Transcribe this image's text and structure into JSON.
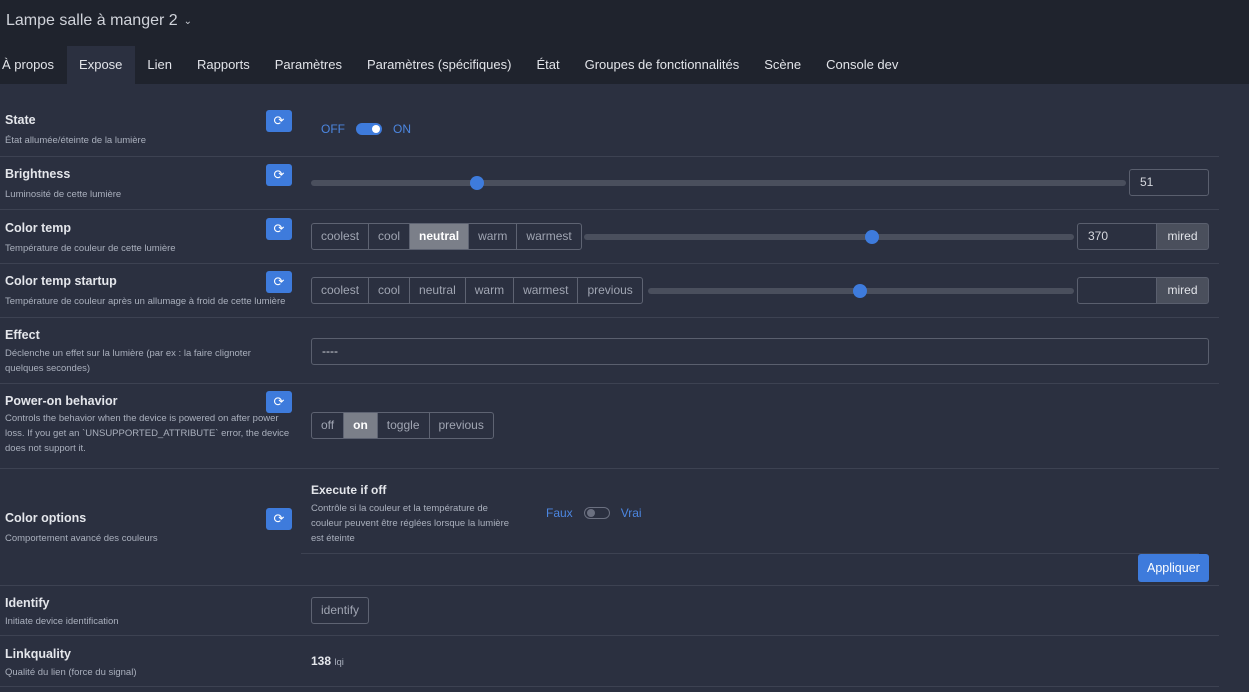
{
  "header": {
    "title": "Lampe salle à manger 2",
    "tabs": [
      "À propos",
      "Expose",
      "Lien",
      "Rapports",
      "Paramètres",
      "Paramètres (spécifiques)",
      "État",
      "Groupes de fonctionnalités",
      "Scène",
      "Console dev"
    ],
    "active_tab": "Expose"
  },
  "state": {
    "name": "State",
    "desc": "État allumée/éteinte de la lumière",
    "off_label": "OFF",
    "on_label": "ON",
    "value": "ON"
  },
  "brightness": {
    "name": "Brightness",
    "desc": "Luminosité de cette lumière",
    "value": "51",
    "min": 0,
    "max": 254
  },
  "color_temp": {
    "name": "Color temp",
    "desc": "Température de couleur de cette lumière",
    "presets": [
      "coolest",
      "cool",
      "neutral",
      "warm",
      "warmest"
    ],
    "selected": "neutral",
    "value": "370",
    "unit": "mired",
    "slider_fraction": 0.59
  },
  "color_temp_startup": {
    "name": "Color temp startup",
    "desc": "Température de couleur après un allumage à froid de cette lumière",
    "presets": [
      "coolest",
      "cool",
      "neutral",
      "warm",
      "warmest",
      "previous"
    ],
    "value": "",
    "unit": "mired",
    "slider_fraction": 0.5
  },
  "effect": {
    "name": "Effect",
    "desc": "Déclenche un effet sur la lumière (par ex : la faire clignoter quelques secondes)",
    "value": "----"
  },
  "power_on": {
    "name": "Power-on behavior",
    "desc": "Controls the behavior when the device is powered on after power loss. If you get an `UNSUPPORTED_ATTRIBUTE` error, the device does not support it.",
    "options": [
      "off",
      "on",
      "toggle",
      "previous"
    ],
    "selected": "on"
  },
  "color_options": {
    "name": "Color options",
    "desc": "Comportement avancé des couleurs",
    "execute_if_off": {
      "name": "Execute if off",
      "desc": "Contrôle si la couleur et la température de couleur peuvent être réglées lorsque la lumière est éteinte",
      "false_label": "Faux",
      "true_label": "Vrai",
      "value": "Faux"
    },
    "apply_label": "Appliquer"
  },
  "identify": {
    "name": "Identify",
    "desc": "Initiate device identification",
    "button_label": "identify"
  },
  "linkquality": {
    "name": "Linkquality",
    "desc": "Qualité du lien (force du signal)",
    "value": "138",
    "unit": "lqi"
  },
  "icons": {
    "refresh": "refresh-icon",
    "chevron": "chevron-down-icon"
  },
  "colors": {
    "accent": "#3e7bdc",
    "background": "#2b3040",
    "header": "#1f232d"
  }
}
